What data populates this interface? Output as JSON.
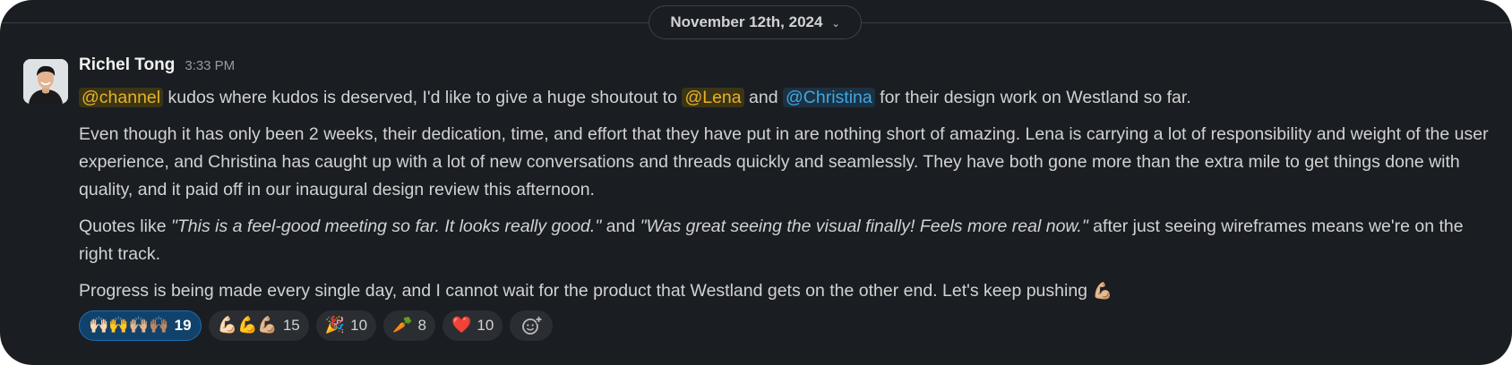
{
  "date_divider": {
    "label": "November 12th, 2024"
  },
  "message": {
    "author": "Richel Tong",
    "time": "3:33 PM",
    "p1": {
      "mention_channel": "@channel",
      "t1": " kudos where kudos is deserved, I'd like to give a huge shoutout to ",
      "mention_lena": "@Lena",
      "t2": " and ",
      "mention_christina": "@Christina",
      "t3": " for their design work on Westland so far."
    },
    "p2": "Even though it has only been 2 weeks, their dedication, time, and effort that they have put in are nothing short of amazing. Lena is carrying a lot of responsibility and weight of the user experience, and Christina has caught up with a lot of new conversations and threads quickly and seamlessly. They have both gone more than the extra mile to get things done with quality, and it paid off in our inaugural design review this afternoon.",
    "p3": {
      "t1": "Quotes like ",
      "q1": "\"This is a feel-good meeting so far. It looks really good.\"",
      "t2": " and ",
      "q2": "\"Was great seeing the visual finally! Feels more real now.\"",
      "t3": " after just seeing wireframes means we're on the right track."
    },
    "p4": {
      "text": "Progress is being made every single day, and I cannot wait for the product that Westland gets on the other end. Let's keep pushing ",
      "emoji": "💪🏼"
    }
  },
  "reactions": [
    {
      "emoji": "🙌🏻🙌🙌🏼🙌🏽",
      "count": "19",
      "active": true
    },
    {
      "emoji": "💪🏻💪💪🏼",
      "count": "15",
      "active": false
    },
    {
      "emoji": "🎉",
      "count": "10",
      "active": false
    },
    {
      "emoji": "🥕",
      "count": "8",
      "active": false
    },
    {
      "emoji": "❤️",
      "count": "10",
      "active": false
    }
  ],
  "add_reaction_icon": "add-emoji-icon",
  "colors": {
    "background": "#1a1d21",
    "mention_channel": "#e8b128",
    "mention_user": "#3ea8e4",
    "active_reaction": "#11426c"
  }
}
